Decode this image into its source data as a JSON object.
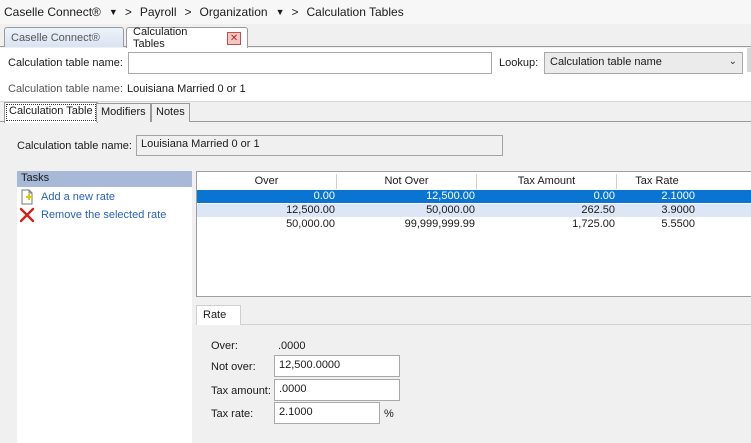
{
  "breadcrumb": {
    "items": [
      "Caselle Connect®",
      "Payroll",
      "Organization",
      "Calculation Tables"
    ]
  },
  "tabs": {
    "home_label": "Caselle Connect®",
    "active_label": "Calculation Tables",
    "close_glyph": "✕"
  },
  "header": {
    "name_label": "Calculation table name:",
    "name_value": "",
    "lookup_label": "Lookup:",
    "lookup_value": "Calculation table name",
    "readout_label": "Calculation table name:",
    "readout_value": "Louisiana Married 0 or 1"
  },
  "inner_tabs": [
    "Calculation Table",
    "Modifiers",
    "Notes"
  ],
  "detail": {
    "name_label": "Calculation table name:",
    "name_value": "Louisiana Married 0 or 1"
  },
  "tasks": {
    "header": "Tasks",
    "items": [
      {
        "label": "Add a new rate",
        "icon": "add-document-icon"
      },
      {
        "label": "Remove the selected rate",
        "icon": "red-x-icon"
      }
    ]
  },
  "grid": {
    "columns": [
      "Over",
      "Not Over",
      "Tax Amount",
      "Tax Rate"
    ],
    "rows": [
      [
        "0.00",
        "12,500.00",
        "0.00",
        "2.1000"
      ],
      [
        "12,500.00",
        "50,000.00",
        "262.50",
        "3.9000"
      ],
      [
        "50,000.00",
        "99,999,999.99",
        "1,725.00",
        "5.5500"
      ]
    ],
    "selected_row": 0
  },
  "rate": {
    "tab_label": "Rate",
    "over_label": "Over:",
    "over_value": ".0000",
    "not_over_label": "Not over:",
    "not_over_value": "12,500.0000",
    "tax_amount_label": "Tax amount:",
    "tax_amount_value": ".0000",
    "tax_rate_label": "Tax rate:",
    "tax_rate_value": "2.1000",
    "tax_rate_unit": "%"
  },
  "colors": {
    "selected_row": "#0a74d2",
    "alt_row": "#dce6f5",
    "tasks_header": "#a7b9d6",
    "link": "#2a62b4",
    "close_red": "#c0504d"
  }
}
